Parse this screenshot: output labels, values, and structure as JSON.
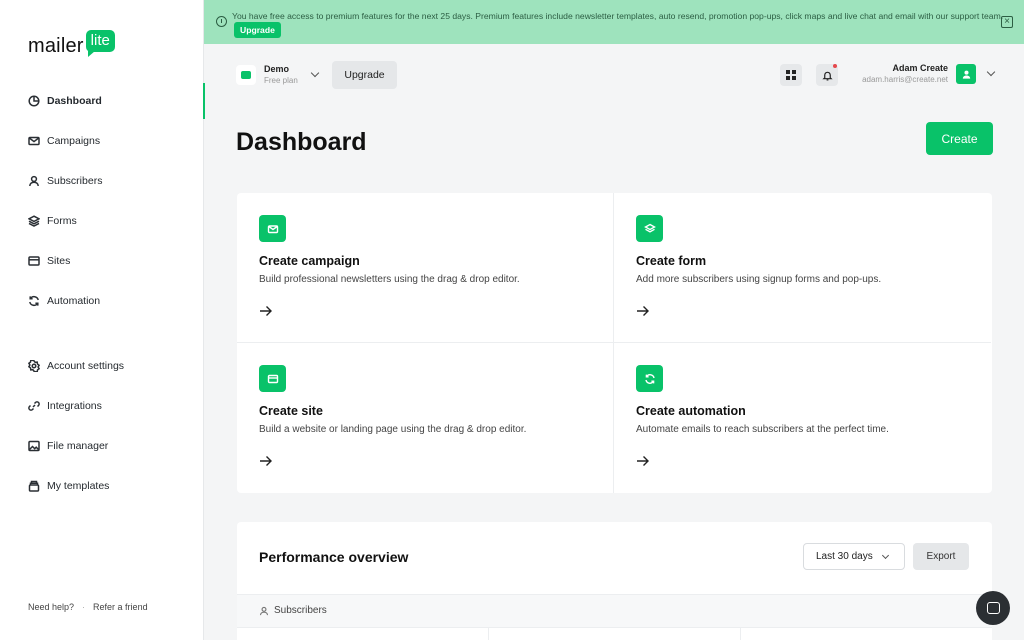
{
  "brand": {
    "logo_text": "mailer",
    "logo_badge": "lite"
  },
  "banner": {
    "text": "You have free access to premium features for the next 25 days. Premium features include newsletter templates, auto resend, promotion pop-ups, click maps and live chat and email with our support team.",
    "upgrade_label": "Upgrade",
    "close_icon": "close-icon"
  },
  "sidebar": {
    "items": [
      {
        "label": "Dashboard",
        "icon": "dashboard-icon",
        "active": true
      },
      {
        "label": "Campaigns",
        "icon": "mail-icon"
      },
      {
        "label": "Subscribers",
        "icon": "user-icon"
      },
      {
        "label": "Forms",
        "icon": "layers-icon"
      },
      {
        "label": "Sites",
        "icon": "browser-icon"
      },
      {
        "label": "Automation",
        "icon": "refresh-icon"
      },
      {
        "label": "Account settings",
        "icon": "gear-icon"
      },
      {
        "label": "Integrations",
        "icon": "link-icon"
      },
      {
        "label": "File manager",
        "icon": "image-icon"
      },
      {
        "label": "My templates",
        "icon": "template-icon"
      }
    ],
    "footer": {
      "help": "Need help?",
      "refer": "Refer a friend"
    }
  },
  "topbar": {
    "account_name": "Demo",
    "account_plan": "Free plan",
    "upgrade_label": "Upgrade",
    "user_name": "Adam Create",
    "user_email": "adam.harris@create.net"
  },
  "page": {
    "title": "Dashboard",
    "create_label": "Create"
  },
  "cards": [
    {
      "title": "Create campaign",
      "desc": "Build professional newsletters using the drag & drop editor.",
      "icon": "mail-icon"
    },
    {
      "title": "Create form",
      "desc": "Add more subscribers using signup forms and pop-ups.",
      "icon": "layers-icon"
    },
    {
      "title": "Create site",
      "desc": "Build a website or landing page using the drag & drop editor.",
      "icon": "browser-icon"
    },
    {
      "title": "Create automation",
      "desc": "Automate emails to reach subscribers at the perfect time.",
      "icon": "refresh-icon"
    }
  ],
  "performance": {
    "title": "Performance overview",
    "range_label": "Last 30 days",
    "export_label": "Export",
    "tab_label": "Subscribers"
  },
  "colors": {
    "brand_green": "#09c269",
    "banner_bg": "#9ee3bd"
  }
}
